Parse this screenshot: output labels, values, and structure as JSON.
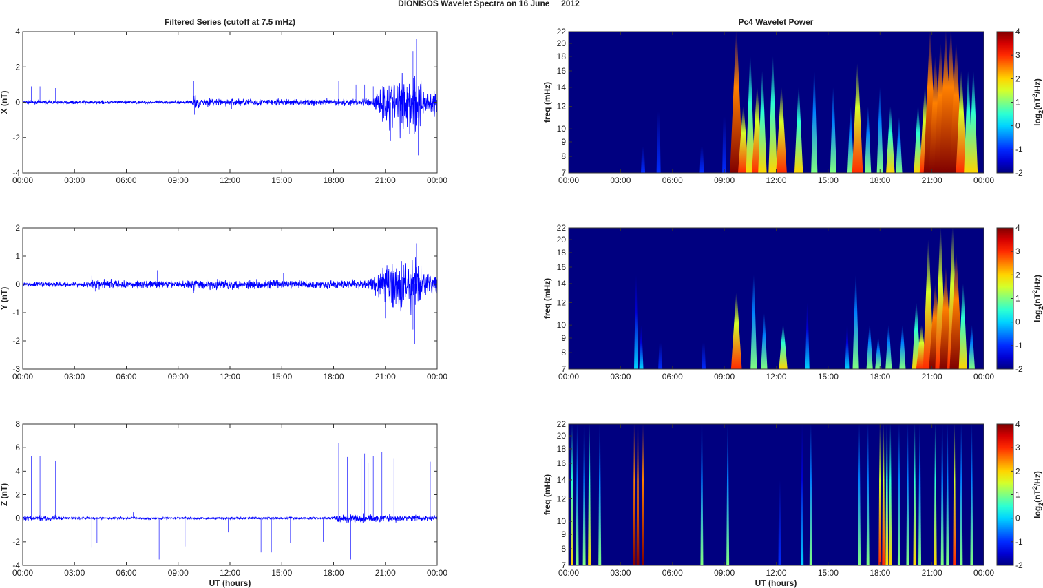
{
  "suptitle": "DIONISOS Wavelet Spectra on 16 June     2012",
  "left_title": "Filtered Series (cutoff at 7.5 mHz)",
  "right_title": "Pc4 Wavelet Power",
  "xlabel": "UT (hours)",
  "x_ticks": [
    "00:00",
    "03:00",
    "06:00",
    "09:00",
    "12:00",
    "15:00",
    "18:00",
    "21:00",
    "00:00"
  ],
  "freq_label": "freq (mHz)",
  "freq_ticks": [
    7,
    8,
    9,
    10,
    12,
    14,
    16,
    18,
    20,
    22
  ],
  "colorbar": {
    "ticks": [
      -2,
      -1,
      0,
      1,
      2,
      3,
      4
    ],
    "label": {
      "base": "log",
      "sub": "2",
      "mid": "(nT",
      "sup": "2",
      "end": "/Hz)"
    }
  },
  "chart_data": [
    {
      "type": "line",
      "ylabel": "X (nT)",
      "ylim": [
        -4,
        4
      ],
      "yticks": [
        -4,
        -2,
        0,
        2,
        4
      ],
      "xlim": [
        0,
        24
      ],
      "envelope": [
        [
          0,
          0.06
        ],
        [
          9.8,
          0.06
        ],
        [
          10,
          0.35
        ],
        [
          10.3,
          0.15
        ],
        [
          17,
          0.12
        ],
        [
          20.2,
          0.15
        ],
        [
          20.5,
          0.5
        ],
        [
          21,
          0.9
        ],
        [
          22,
          1.1
        ],
        [
          22.7,
          1.4
        ],
        [
          23.2,
          0.6
        ],
        [
          24,
          0.5
        ]
      ],
      "spikes": [
        [
          0.5,
          0.9
        ],
        [
          1,
          0.9
        ],
        [
          1.9,
          0.8
        ],
        [
          9.9,
          1.2
        ],
        [
          9.95,
          -0.7
        ],
        [
          12.1,
          -0.4
        ],
        [
          18.3,
          1.2
        ],
        [
          18.6,
          1.0
        ],
        [
          19.3,
          1.0
        ],
        [
          19.8,
          1.0
        ],
        [
          20.3,
          0.9
        ],
        [
          21.3,
          -2.2
        ],
        [
          22.4,
          -1.8
        ],
        [
          22.6,
          2.9
        ],
        [
          22.8,
          3.6
        ],
        [
          22.9,
          -3.0
        ]
      ]
    },
    {
      "type": "line",
      "ylabel": "Y (nT)",
      "ylim": [
        -3,
        2
      ],
      "yticks": [
        -3,
        -2,
        -1,
        0,
        1,
        2
      ],
      "xlim": [
        0,
        24
      ],
      "envelope": [
        [
          0,
          0.06
        ],
        [
          3.5,
          0.06
        ],
        [
          4,
          0.12
        ],
        [
          9.5,
          0.08
        ],
        [
          10,
          0.12
        ],
        [
          20,
          0.1
        ],
        [
          20.5,
          0.3
        ],
        [
          21,
          0.5
        ],
        [
          22,
          0.6
        ],
        [
          22.7,
          0.7
        ],
        [
          23.2,
          0.3
        ],
        [
          24,
          0.25
        ]
      ],
      "spikes": [
        [
          4.0,
          0.3
        ],
        [
          4.2,
          -0.25
        ],
        [
          7.8,
          0.5
        ],
        [
          9.9,
          -0.3
        ],
        [
          15.1,
          0.4
        ],
        [
          18.2,
          0.4
        ],
        [
          21.0,
          -1.2
        ],
        [
          22.6,
          -1.6
        ],
        [
          22.7,
          -2.1
        ],
        [
          22.8,
          1.45
        ]
      ]
    },
    {
      "type": "line",
      "ylabel": "Z (nT)",
      "ylim": [
        -4,
        8
      ],
      "yticks": [
        -4,
        -2,
        0,
        2,
        4,
        6,
        8
      ],
      "xlim": [
        0,
        24
      ],
      "envelope": [
        [
          0,
          0.15
        ],
        [
          2,
          0.15
        ],
        [
          2.3,
          0.07
        ],
        [
          17.9,
          0.07
        ],
        [
          18.3,
          0.25
        ],
        [
          24,
          0.15
        ]
      ],
      "spikes": [
        [
          0.5,
          5.3
        ],
        [
          1.0,
          5.3
        ],
        [
          1.9,
          4.9
        ],
        [
          3.85,
          -2.5
        ],
        [
          4.0,
          -2.5
        ],
        [
          4.3,
          -2.1
        ],
        [
          6.4,
          0.5
        ],
        [
          7.9,
          -3.5
        ],
        [
          9.4,
          -2.4
        ],
        [
          11.9,
          -1.2
        ],
        [
          13.8,
          -2.9
        ],
        [
          14.4,
          -2.9
        ],
        [
          15.5,
          -2.1
        ],
        [
          16.8,
          -2.2
        ],
        [
          17.4,
          -2.0
        ],
        [
          18.3,
          6.4
        ],
        [
          18.6,
          4.9
        ],
        [
          18.8,
          5.2
        ],
        [
          19.0,
          -3.5
        ],
        [
          19.6,
          5.1
        ],
        [
          19.8,
          5.5
        ],
        [
          20.0,
          4.7
        ],
        [
          20.3,
          5.3
        ],
        [
          20.8,
          5.6
        ],
        [
          21.5,
          5.1
        ],
        [
          23.3,
          4.5
        ],
        [
          23.6,
          4.8
        ]
      ]
    },
    {
      "type": "heatmap",
      "title": "Pc4 Wavelet Power",
      "ylim": [
        7,
        22
      ],
      "clim": [
        -2,
        4
      ],
      "events_hour_topfreq_power": [
        [
          4.3,
          10,
          -1
        ],
        [
          5.2,
          16,
          -1
        ],
        [
          7.7,
          10,
          -1
        ],
        [
          9.0,
          15,
          -1
        ],
        [
          9.7,
          22,
          4
        ],
        [
          10.1,
          12,
          3
        ],
        [
          10.5,
          18,
          2
        ],
        [
          10.9,
          14,
          3
        ],
        [
          11.2,
          16,
          2
        ],
        [
          11.8,
          18,
          2
        ],
        [
          12.3,
          14,
          3
        ],
        [
          13.3,
          14,
          2
        ],
        [
          14.2,
          16,
          1
        ],
        [
          15.3,
          14,
          1
        ],
        [
          16.3,
          12,
          1
        ],
        [
          16.7,
          17,
          3
        ],
        [
          17.3,
          12,
          1
        ],
        [
          18.0,
          14,
          1
        ],
        [
          18.6,
          12,
          2
        ],
        [
          19.1,
          11,
          1
        ],
        [
          20.2,
          12,
          2
        ],
        [
          20.6,
          14,
          3
        ],
        [
          20.9,
          22,
          4
        ],
        [
          21.2,
          18,
          4
        ],
        [
          21.5,
          20,
          4
        ],
        [
          21.8,
          22,
          4
        ],
        [
          22.1,
          22,
          4
        ],
        [
          22.4,
          20,
          4
        ],
        [
          22.7,
          16,
          3
        ],
        [
          23.1,
          16,
          2
        ],
        [
          23.4,
          16,
          2
        ]
      ]
    },
    {
      "type": "heatmap",
      "ylim": [
        7,
        22
      ],
      "clim": [
        -2,
        4
      ],
      "events_hour_topfreq_power": [
        [
          3.9,
          15,
          0
        ],
        [
          4.2,
          10,
          0
        ],
        [
          5.3,
          10,
          -1
        ],
        [
          7.8,
          10,
          -1
        ],
        [
          9.7,
          13,
          3
        ],
        [
          10.7,
          15,
          1
        ],
        [
          11.3,
          11,
          1
        ],
        [
          12.4,
          10,
          2
        ],
        [
          13.8,
          12,
          0
        ],
        [
          16.1,
          10,
          0
        ],
        [
          16.6,
          15,
          1
        ],
        [
          17.4,
          10,
          1
        ],
        [
          17.9,
          9,
          1
        ],
        [
          18.5,
          10,
          1
        ],
        [
          19.3,
          10,
          1
        ],
        [
          20.1,
          12,
          2
        ],
        [
          20.4,
          10,
          3
        ],
        [
          20.8,
          20,
          3
        ],
        [
          21.2,
          14,
          4
        ],
        [
          21.5,
          22,
          3
        ],
        [
          21.8,
          16,
          4
        ],
        [
          22.2,
          22,
          3
        ],
        [
          22.4,
          18,
          4
        ],
        [
          22.8,
          14,
          2
        ],
        [
          23.3,
          10,
          1
        ]
      ]
    },
    {
      "type": "heatmap",
      "ylim": [
        7,
        22
      ],
      "clim": [
        -2,
        4
      ],
      "events_hour_topfreq_power": [
        [
          0.2,
          22,
          2
        ],
        [
          0.5,
          22,
          1
        ],
        [
          0.9,
          22,
          1
        ],
        [
          1.2,
          22,
          2
        ],
        [
          1.8,
          22,
          1
        ],
        [
          3.8,
          22,
          4
        ],
        [
          4.0,
          22,
          4
        ],
        [
          4.3,
          22,
          4
        ],
        [
          7.7,
          22,
          1
        ],
        [
          9.2,
          22,
          1
        ],
        [
          12.2,
          22,
          -1
        ],
        [
          13.5,
          22,
          0
        ],
        [
          14.0,
          22,
          1
        ],
        [
          16.8,
          22,
          1
        ],
        [
          17.3,
          22,
          1
        ],
        [
          18.0,
          22,
          3
        ],
        [
          18.2,
          22,
          3
        ],
        [
          18.4,
          22,
          2
        ],
        [
          18.6,
          22,
          2
        ],
        [
          19.1,
          22,
          1
        ],
        [
          19.6,
          22,
          1
        ],
        [
          20.0,
          22,
          2
        ],
        [
          20.3,
          22,
          1
        ],
        [
          21.2,
          22,
          2
        ],
        [
          21.6,
          22,
          1
        ],
        [
          21.9,
          22,
          1
        ],
        [
          22.3,
          22,
          3
        ],
        [
          22.7,
          22,
          1
        ],
        [
          23.3,
          22,
          1
        ]
      ]
    }
  ]
}
